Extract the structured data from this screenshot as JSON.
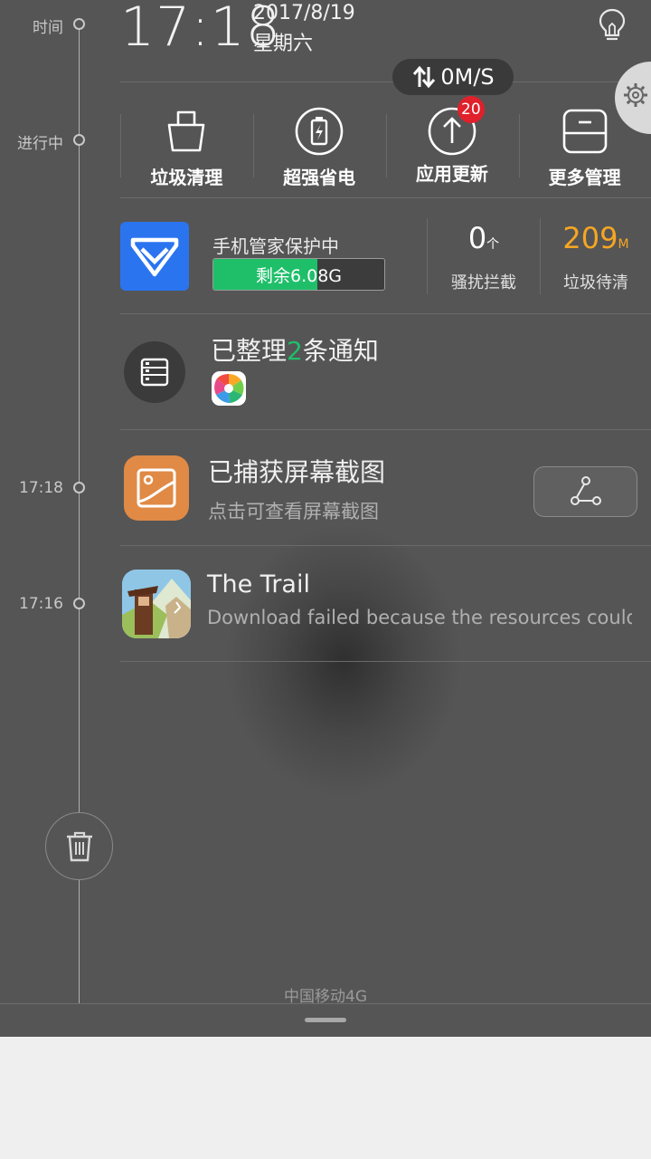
{
  "timeline": {
    "header_label": "时间",
    "in_progress_label": "进行中",
    "entries": [
      {
        "time": "17:18"
      },
      {
        "time": "17:16"
      }
    ]
  },
  "header": {
    "clock": "17:18",
    "date": "2017/8/19",
    "weekday": "星期六"
  },
  "network": {
    "speed": "0M/S",
    "icon": "up-down-arrows-icon"
  },
  "quick_actions": [
    {
      "label": "垃圾清理",
      "icon": "broom-icon"
    },
    {
      "label": "超强省电",
      "icon": "battery-icon"
    },
    {
      "label": "应用更新",
      "icon": "upload-arrow-icon",
      "badge": "20"
    },
    {
      "label": "更多管理",
      "icon": "manage-icon"
    }
  ],
  "guard": {
    "title": "手机管家保护中",
    "storage_label": "剩余6.08G",
    "storage_fill_fraction": 0.61,
    "brand_color": "#2b74f0",
    "fill_color": "#1fbf6a"
  },
  "stats": {
    "blocked": {
      "value": "0",
      "unit": "个",
      "label": "骚扰拦截"
    },
    "junk": {
      "value": "209",
      "unit": "M",
      "label": "垃圾待清",
      "color": "#f5a623"
    }
  },
  "notifications": {
    "organized": {
      "prefix": "已整理",
      "count": "2",
      "suffix": "条通知",
      "count_color": "#1fbf6a"
    },
    "screenshot": {
      "title": "已捕获屏幕截图",
      "subtitle": "点击可查看屏幕截图"
    },
    "game": {
      "title": "The Trail",
      "subtitle": "Download failed because the resources could…"
    }
  },
  "footer": {
    "carrier": "中国移动4G"
  }
}
